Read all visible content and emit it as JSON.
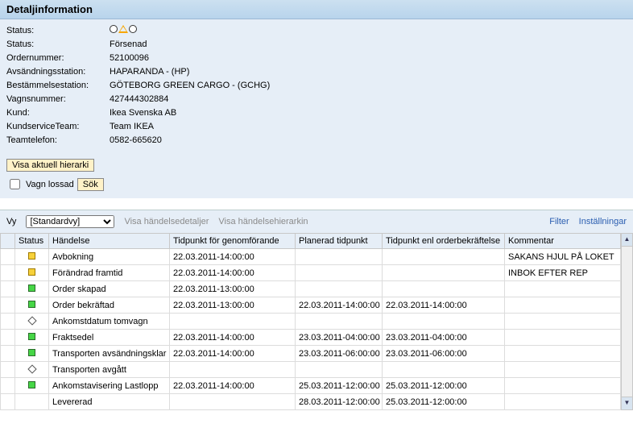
{
  "header": {
    "title": "Detaljinformation"
  },
  "info": {
    "rows": [
      {
        "label": "Status:",
        "value": ""
      },
      {
        "label": "Status:",
        "value": "Försenad"
      },
      {
        "label": "Ordernummer:",
        "value": "52100096"
      },
      {
        "label": "Avsändningsstation:",
        "value": "HAPARANDA - (HP)"
      },
      {
        "label": "Bestämmelsestation:",
        "value": "GÖTEBORG GREEN CARGO - (GCHG)"
      },
      {
        "label": "Vagnsnummer:",
        "value": "427444302884"
      },
      {
        "label": "Kund:",
        "value": "Ikea Svenska AB"
      },
      {
        "label": "KundserviceTeam:",
        "value": "Team IKEA"
      },
      {
        "label": "Teamtelefon:",
        "value": "0582-665620"
      }
    ]
  },
  "actions": {
    "show_hierarchy": "Visa aktuell hierarki",
    "wagon_unloaded": "Vagn lossad",
    "search": "Sök"
  },
  "toolbar": {
    "vy_label": "Vy",
    "vy_value": "[Standardvy]",
    "show_details": "Visa händelsedetaljer",
    "show_event_hierarchy": "Visa händelsehierarkin",
    "filter": "Filter",
    "settings": "Inställningar"
  },
  "grid": {
    "headers": {
      "status": "Status",
      "event": "Händelse",
      "t1": "Tidpunkt för genomförande",
      "t2": "Planerad tidpunkt",
      "t3": "Tidpunkt enl orderbekräftelse",
      "comment": "Kommentar"
    },
    "rows": [
      {
        "icon": "yellow",
        "event": "Avbokning",
        "t1": "22.03.2011-14:00:00",
        "t2": "",
        "t3": "",
        "comment": "SAKANS HJUL PÅ LOKET"
      },
      {
        "icon": "yellow",
        "event": "Förändrad framtid",
        "t1": "22.03.2011-14:00:00",
        "t2": "",
        "t3": "",
        "comment": "INBOK EFTER REP"
      },
      {
        "icon": "green",
        "event": "Order skapad",
        "t1": "22.03.2011-13:00:00",
        "t2": "",
        "t3": "",
        "comment": ""
      },
      {
        "icon": "green",
        "event": "Order bekräftad",
        "t1": "22.03.2011-13:00:00",
        "t2": "22.03.2011-14:00:00",
        "t3": "22.03.2011-14:00:00",
        "comment": ""
      },
      {
        "icon": "diamond",
        "event": "Ankomstdatum tomvagn",
        "t1": "",
        "t2": "",
        "t3": "",
        "comment": ""
      },
      {
        "icon": "green",
        "event": "Fraktsedel",
        "t1": "22.03.2011-14:00:00",
        "t2": "23.03.2011-04:00:00",
        "t3": "23.03.2011-04:00:00",
        "comment": ""
      },
      {
        "icon": "green",
        "event": "Transporten avsändningsklar",
        "t1": "22.03.2011-14:00:00",
        "t2": "23.03.2011-06:00:00",
        "t3": "23.03.2011-06:00:00",
        "comment": ""
      },
      {
        "icon": "diamond",
        "event": "Transporten avgått",
        "t1": "",
        "t2": "",
        "t3": "",
        "comment": ""
      },
      {
        "icon": "green",
        "event": "Ankomstavisering Lastlopp",
        "t1": "22.03.2011-14:00:00",
        "t2": "25.03.2011-12:00:00",
        "t3": "25.03.2011-12:00:00",
        "comment": ""
      },
      {
        "icon": "red",
        "event": "Levererad",
        "t1": "",
        "t2": "28.03.2011-12:00:00",
        "t3": "25.03.2011-12:00:00",
        "comment": ""
      }
    ]
  }
}
